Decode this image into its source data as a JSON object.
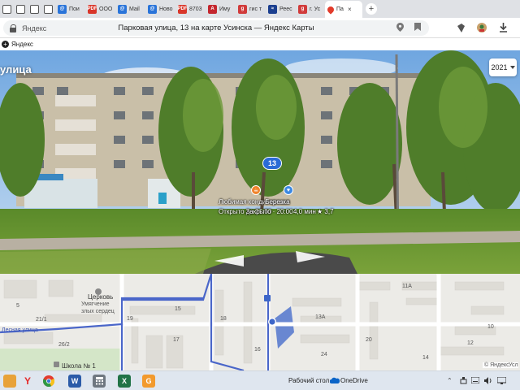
{
  "browser": {
    "tabs": [
      {
        "label": "",
        "color": "#ffffff",
        "glyph": ""
      },
      {
        "label": "",
        "color": "#ffffff",
        "glyph": ""
      },
      {
        "label": "",
        "color": "#ffffff",
        "glyph": ""
      },
      {
        "label": "",
        "color": "#ffffff",
        "glyph": ""
      },
      {
        "label": "Пои",
        "color": "#2a74d9",
        "glyph": "@"
      },
      {
        "label": "ООО",
        "color": "#d9362a",
        "glyph": "PDF"
      },
      {
        "label": "Mail",
        "color": "#2a74d9",
        "glyph": "@"
      },
      {
        "label": "Ново",
        "color": "#2a74d9",
        "glyph": "@"
      },
      {
        "label": "8703",
        "color": "#d9362a",
        "glyph": "PDF"
      },
      {
        "label": "Иму",
        "color": "#c4262e",
        "glyph": "A"
      },
      {
        "label": "гис т",
        "color": "#d13b3b",
        "glyph": "g"
      },
      {
        "label": "Реес",
        "color": "#1b3f8f",
        "glyph": "≈"
      },
      {
        "label": "г. Ус",
        "color": "#d13b3b",
        "glyph": "g"
      }
    ],
    "active_tab": {
      "label": "Па",
      "close": "×"
    },
    "new_tab": "+",
    "address": {
      "host": "Яндекс",
      "title": "Парковая улица, 13 на карте Усинска — Яндекс Карты"
    },
    "bookmark": "Яндекс"
  },
  "panorama": {
    "street_label": "улица",
    "year": "2021",
    "building_pin": "13",
    "poi": {
      "name": "Любимая кондитерская",
      "status": "Открыто до 20:00",
      "time": "4,0 мин",
      "rating": "3,7",
      "overlap_name": "Березка",
      "overlap_status": "Закрыто · 20:00"
    }
  },
  "map": {
    "labels": [
      "Церковь",
      "Умягчение",
      "злых сердец",
      "21/1",
      "26/2",
      "Школа № 1",
      "15",
      "17",
      "16",
      "18",
      "19",
      "13А",
      "11А",
      "10",
      "12",
      "14",
      "20",
      "24",
      "5"
    ],
    "street": "Лесная улица"
  },
  "taskbar": {
    "desktop_label": "Рабочий стол",
    "onedrive": "OneDrive",
    "yandex_mini": "© Яндекс",
    "yandex_mini2": "Усл"
  },
  "colors": {
    "accent": "#2a6bd6",
    "poi_orange": "#f0832a",
    "poi_blue": "#3b88e3",
    "road_blue": "#4a66c9"
  }
}
